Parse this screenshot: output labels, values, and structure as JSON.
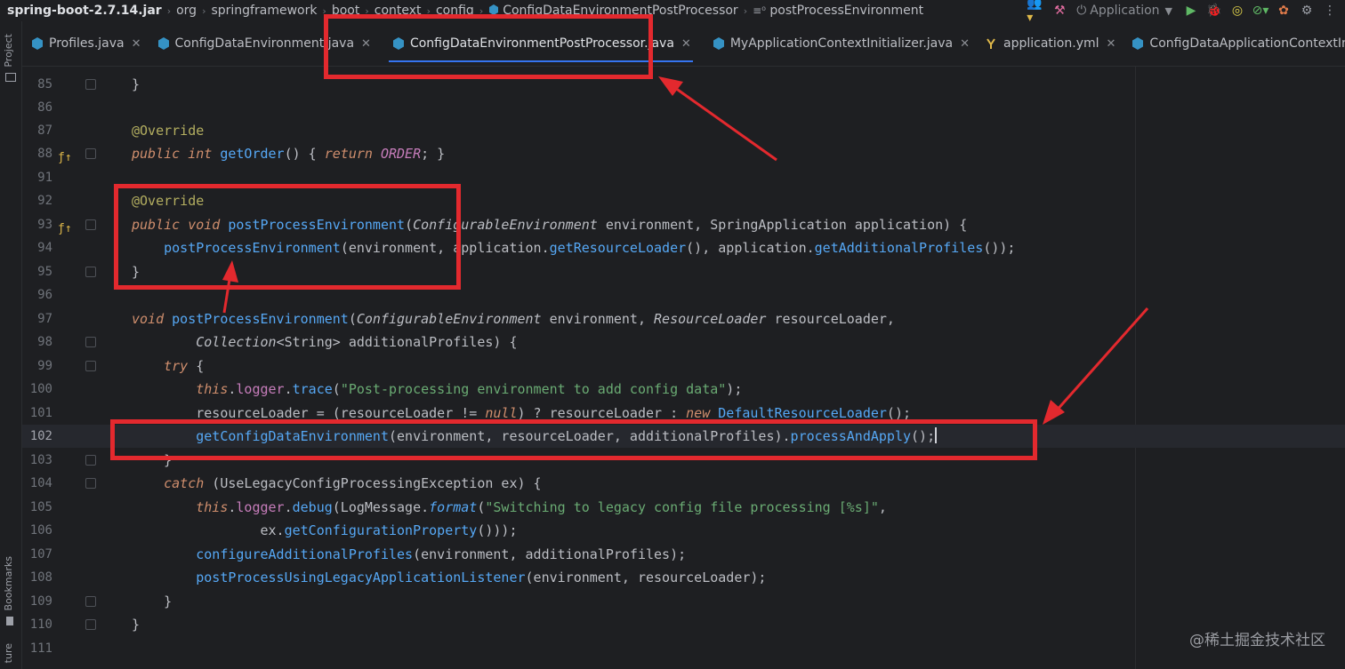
{
  "breadcrumb": {
    "items": [
      "spring-boot-2.7.14.jar",
      "org",
      "springframework",
      "boot",
      "context",
      "config",
      "ConfigDataEnvironmentPostProcessor",
      "postProcessEnvironment"
    ]
  },
  "toolbar": {
    "run_config_label": "Application"
  },
  "left_strip": {
    "project_label": "Project",
    "bookmarks_label": "Bookmarks",
    "structure_label": "ture"
  },
  "tabs": [
    {
      "label": "Profiles.java",
      "icon": "class-icon",
      "active": false
    },
    {
      "label": "ConfigDataEnvironment.java",
      "icon": "class-icon",
      "active": false
    },
    {
      "label": "ConfigDataEnvironmentPostProcessor.java",
      "icon": "class-icon",
      "active": true
    },
    {
      "label": "MyApplicationContextInitializer.java",
      "icon": "class-icon",
      "active": false
    },
    {
      "label": "application.yml",
      "icon": "yaml-icon",
      "active": false
    },
    {
      "label": "ConfigDataApplicationContextInitializer.class",
      "icon": "class-icon",
      "active": false
    }
  ],
  "editor": {
    "lines": [
      {
        "n": "85"
      },
      {
        "n": "86"
      },
      {
        "n": "87"
      },
      {
        "n": "88"
      },
      {
        "n": "91"
      },
      {
        "n": "92"
      },
      {
        "n": "93"
      },
      {
        "n": "94"
      },
      {
        "n": "95"
      },
      {
        "n": "96"
      },
      {
        "n": "97"
      },
      {
        "n": "98"
      },
      {
        "n": "99"
      },
      {
        "n": "100"
      },
      {
        "n": "101"
      },
      {
        "n": "102"
      },
      {
        "n": "103"
      },
      {
        "n": "104"
      },
      {
        "n": "105"
      },
      {
        "n": "106"
      },
      {
        "n": "107"
      },
      {
        "n": "108"
      },
      {
        "n": "109"
      },
      {
        "n": "110"
      },
      {
        "n": "111"
      }
    ]
  },
  "watermark": "@稀土掘金技术社区",
  "colors": {
    "annotation_red": "#e3292e",
    "accent_blue": "#3574f0",
    "editor_bg": "#1e1f22"
  }
}
